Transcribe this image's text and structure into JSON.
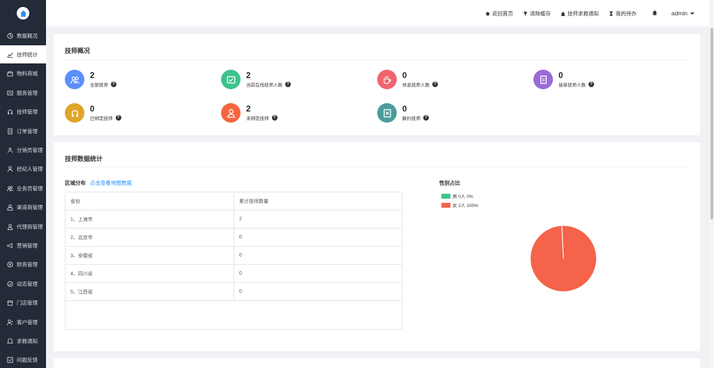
{
  "sidebar": {
    "items": [
      {
        "label": "数据概况",
        "icon": "dashboard-icon",
        "active": false
      },
      {
        "label": "技师统计",
        "icon": "chart-icon",
        "active": true
      },
      {
        "label": "物料商城",
        "icon": "shop-icon",
        "active": false
      },
      {
        "label": "服务管理",
        "icon": "service-icon",
        "active": false
      },
      {
        "label": "技师管理",
        "icon": "headset-icon",
        "active": false
      },
      {
        "label": "订单管理",
        "icon": "order-icon",
        "active": false
      },
      {
        "label": "分销员管理",
        "icon": "team-icon",
        "active": false
      },
      {
        "label": "经纪人管理",
        "icon": "user-icon",
        "active": false
      },
      {
        "label": "业务员管理",
        "icon": "users-icon",
        "active": false
      },
      {
        "label": "渠道商管理",
        "icon": "channel-icon",
        "active": false
      },
      {
        "label": "代理商管理",
        "icon": "agent-icon",
        "active": false
      },
      {
        "label": "营销管理",
        "icon": "marketing-icon",
        "active": false
      },
      {
        "label": "财务管理",
        "icon": "finance-icon",
        "active": false
      },
      {
        "label": "动态管理",
        "icon": "dynamic-icon",
        "active": false
      },
      {
        "label": "门店管理",
        "icon": "store-icon",
        "active": false
      },
      {
        "label": "客户管理",
        "icon": "customer-icon",
        "active": false
      },
      {
        "label": "求救通知",
        "icon": "bell-icon",
        "active": false
      },
      {
        "label": "问题反馈",
        "icon": "feedback-icon",
        "active": false
      }
    ]
  },
  "topbar": {
    "home": "返回首页",
    "clear_cache": "清除缓存",
    "sos_notice": "技师求救通知",
    "todo": "我的待办",
    "user": "admin"
  },
  "overview": {
    "title": "技师概况",
    "stats": [
      {
        "value": "2",
        "label": "全部技师",
        "color": "#5b8ff9",
        "icon": "users-icon"
      },
      {
        "value": "2",
        "label": "当前在线技师人数",
        "color": "#3cc48c",
        "icon": "check-icon"
      },
      {
        "value": "0",
        "label": "休息技师人数",
        "color": "#f0646e",
        "icon": "coffee-icon"
      },
      {
        "value": "0",
        "label": "接单技师人数",
        "color": "#9b6ad6",
        "icon": "order-icon"
      },
      {
        "value": "0",
        "label": "已绑定技师",
        "color": "#e0a528",
        "icon": "headset-icon"
      },
      {
        "value": "2",
        "label": "未绑定技师",
        "color": "#f5663f",
        "icon": "user-icon"
      },
      {
        "value": "0",
        "label": "解约技师",
        "color": "#4a9d9c",
        "icon": "terminate-icon"
      }
    ]
  },
  "stats_section": {
    "title": "技师数据统计",
    "region_title": "区域分布",
    "region_link": "点击查看地图数据",
    "table": {
      "headers": [
        "省份",
        "累计技师数量"
      ],
      "rows": [
        [
          "1、上海市",
          "2"
        ],
        [
          "2、北京市",
          "0"
        ],
        [
          "3、安徽省",
          "0"
        ],
        [
          "4、四川省",
          "0"
        ],
        [
          "5、江西省",
          "0"
        ]
      ]
    },
    "gender_title": "性别占比",
    "legend": [
      {
        "text": "男  0人  0%",
        "color": "#3cc48c"
      },
      {
        "text": "女  2人  100%",
        "color": "#f5634a"
      }
    ]
  },
  "chart_data": {
    "type": "pie",
    "title": "性别占比",
    "slices": [
      {
        "name": "男",
        "value": 0,
        "color": "#3cc48c"
      },
      {
        "name": "女",
        "value": 2,
        "color": "#f5634a"
      }
    ]
  }
}
